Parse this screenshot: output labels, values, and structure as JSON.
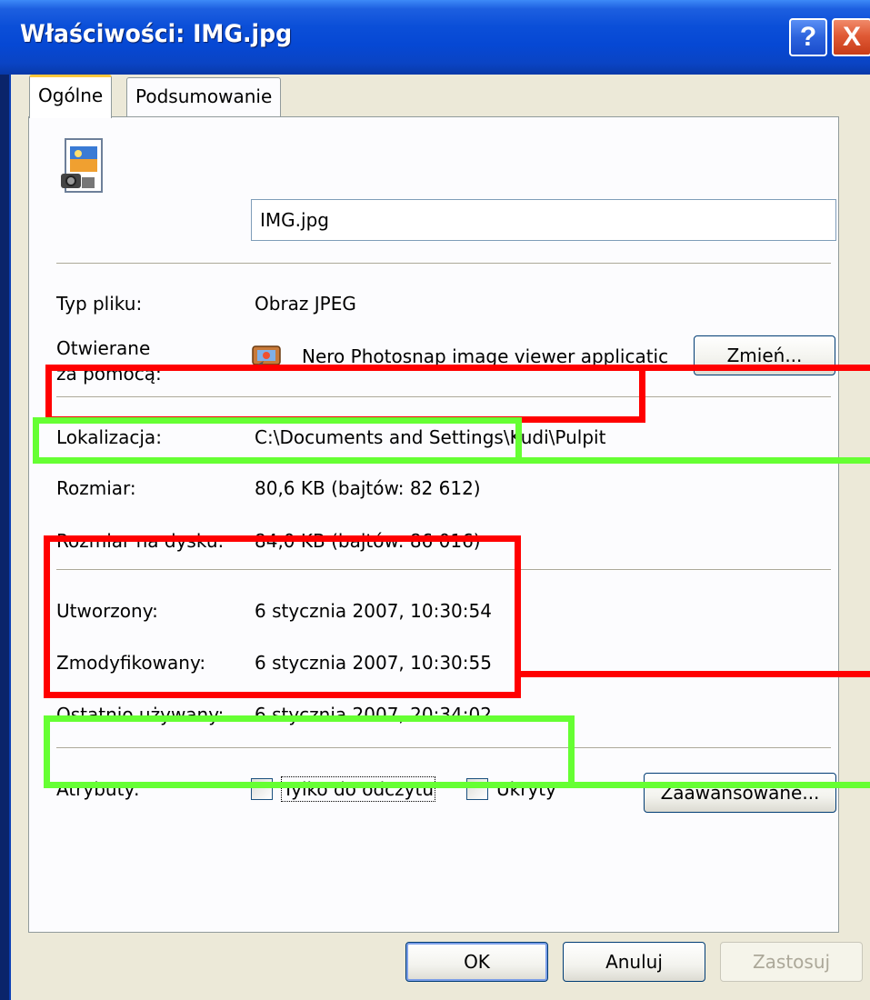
{
  "window": {
    "title": "Właściwości: IMG.jpg"
  },
  "titlebar_buttons": {
    "help": "?",
    "close": "X"
  },
  "tabs": [
    {
      "label": "Ogólne",
      "active": true
    },
    {
      "label": "Podsumowanie",
      "active": false
    }
  ],
  "file": {
    "icon": "jpeg-image-file-icon",
    "name": "IMG.jpg"
  },
  "props": {
    "type_label": "Typ pliku:",
    "type_value": "Obraz JPEG",
    "opens_label_1": "Otwierane",
    "opens_label_2": "za pomocą:",
    "opens_icon": "nero-photosnap-icon",
    "opens_value": "Nero Photosnap image viewer applicatic",
    "change_button": "Zmień...",
    "location_label": "Lokalizacja:",
    "location_value": "C:\\Documents and Settings\\Kudi\\Pulpit",
    "size_label": "Rozmiar:",
    "size_value": "80,6 KB (bajtów: 82 612)",
    "disk_size_label": "Rozmiar na dysku:",
    "disk_size_value": "84,0 KB (bajtów: 86 016)",
    "created_label": "Utworzony:",
    "created_value": "6 stycznia 2007, 10:30:54",
    "modified_label": "Zmodyfikowany:",
    "modified_value": "6 stycznia 2007, 10:30:55",
    "accessed_label": "Ostatnio używany:",
    "accessed_value": "6 stycznia 2007, 20:34:02",
    "attributes_label": "Atrybuty:",
    "readonly_label": "Tylko do odczytu",
    "readonly_checked": false,
    "hidden_label": "Ukryty",
    "hidden_checked": false,
    "advanced_button": "Zaawansowane..."
  },
  "footer": {
    "ok": "OK",
    "cancel": "Anuluj",
    "apply": "Zastosuj"
  },
  "colors": {
    "highlight_red": "#ff0000",
    "highlight_green": "#66ff33",
    "titlebar": "#0648d4"
  }
}
